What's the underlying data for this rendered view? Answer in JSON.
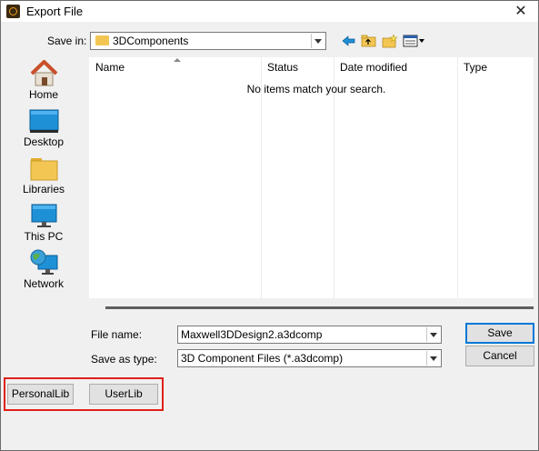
{
  "window": {
    "title": "Export File"
  },
  "save_in": {
    "label": "Save in:",
    "value": "3DComponents"
  },
  "places": [
    {
      "label": "Home",
      "icon": "home-icon"
    },
    {
      "label": "Desktop",
      "icon": "desktop-icon"
    },
    {
      "label": "Libraries",
      "icon": "libraries-icon"
    },
    {
      "label": "This PC",
      "icon": "this-pc-icon"
    },
    {
      "label": "Network",
      "icon": "network-icon"
    }
  ],
  "file_list": {
    "columns": [
      "Name",
      "Status",
      "Date modified",
      "Type"
    ],
    "empty_message": "No items match your search."
  },
  "file_name": {
    "label": "File name:",
    "value": "Maxwell3DDesign2.a3dcomp"
  },
  "save_as_type": {
    "label": "Save as type:",
    "value": "3D Component Files (*.a3dcomp)"
  },
  "buttons": {
    "save": "Save",
    "cancel": "Cancel",
    "personal_lib": "PersonalLib",
    "user_lib": "UserLib"
  },
  "colors": {
    "highlight": "#e0201a",
    "default_button": "#0078d7",
    "accent": "#1e90d6"
  }
}
